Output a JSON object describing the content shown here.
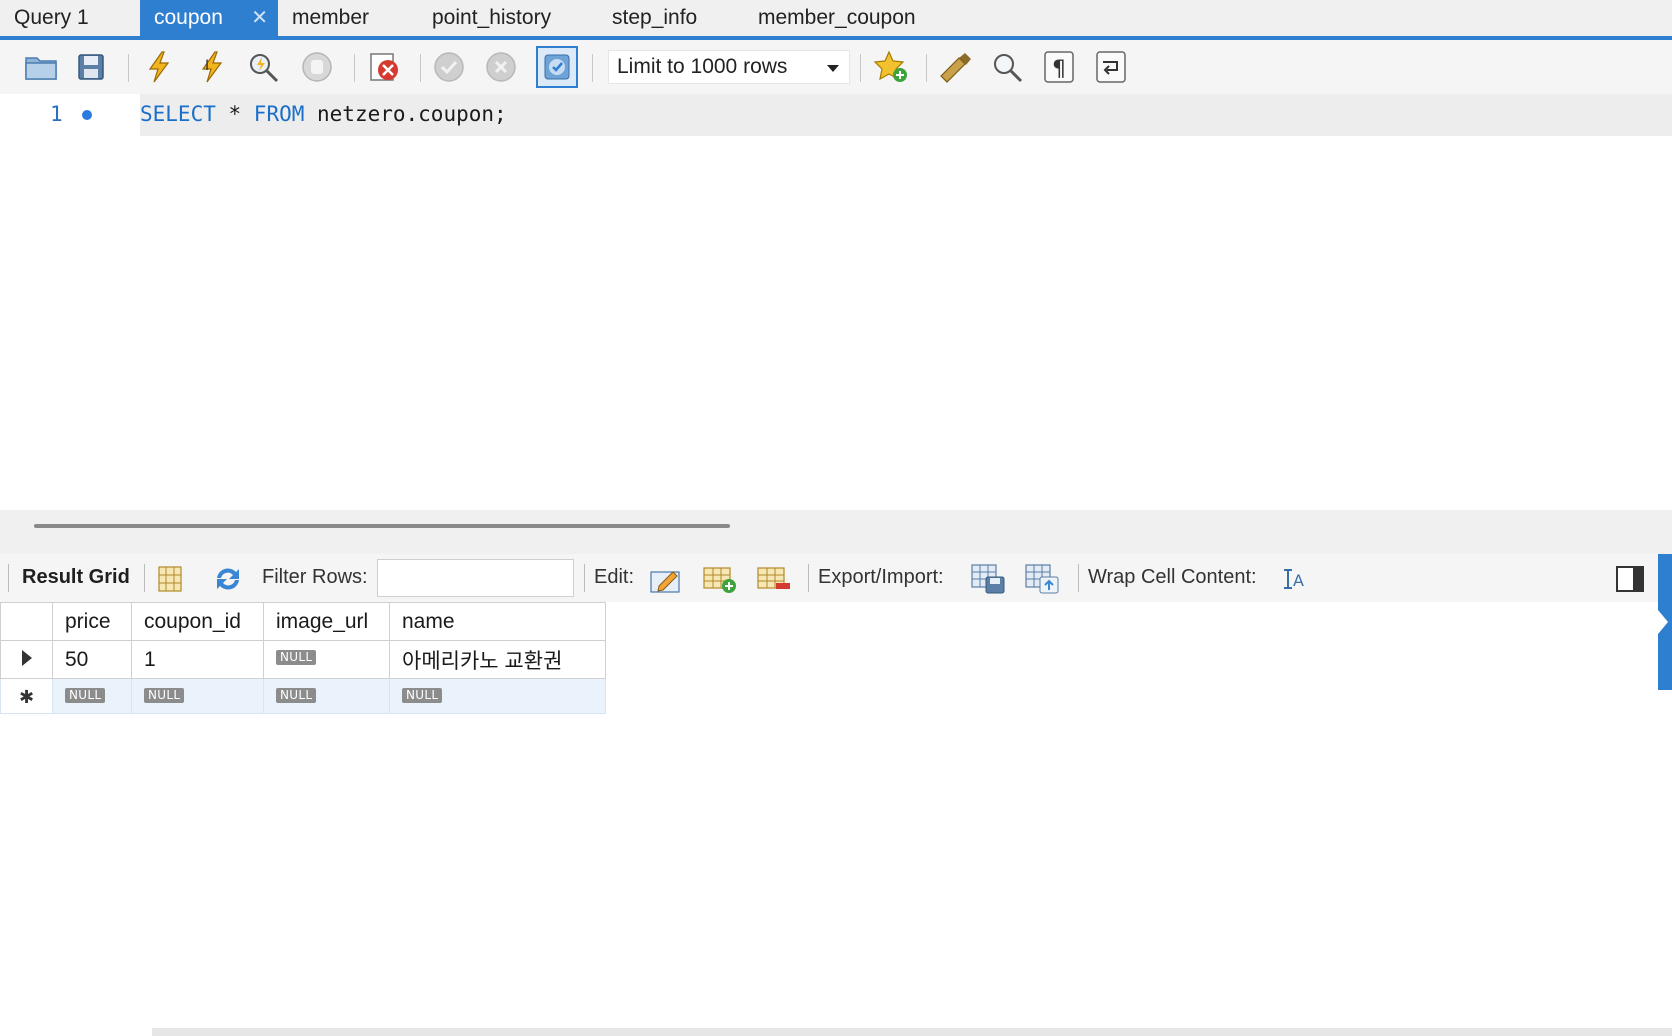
{
  "tabs": [
    {
      "label": "Query 1",
      "active": false
    },
    {
      "label": "coupon",
      "active": true,
      "close": "✕"
    },
    {
      "label": "member",
      "active": false
    },
    {
      "label": "point_history",
      "active": false
    },
    {
      "label": "step_info",
      "active": false
    },
    {
      "label": "member_coupon",
      "active": false
    }
  ],
  "toolbar": {
    "limit_value": "Limit to 1000 rows",
    "icons": [
      "open-file-icon",
      "save-icon",
      "execute-icon",
      "execute-current-icon",
      "explain-icon",
      "stop-icon",
      "toggle-error-icon",
      "commit-icon",
      "rollback-icon",
      "autocommit-icon",
      "bookmark-icon",
      "beautify-icon",
      "find-icon",
      "invisible-chars-icon",
      "wrap-icon"
    ]
  },
  "editor": {
    "line_number": "1",
    "code": {
      "kw1": "SELECT",
      "p1": " * ",
      "kw2": "FROM",
      "p2": " netzero.coupon;"
    }
  },
  "result_toolbar": {
    "result_grid_label": "Result Grid",
    "filter_label": "Filter Rows:",
    "filter_value": "",
    "edit_label": "Edit:",
    "export_label": "Export/Import:",
    "wrap_label": "Wrap Cell Content:"
  },
  "grid": {
    "columns": [
      "price",
      "coupon_id",
      "image_url",
      "name"
    ],
    "rows": [
      {
        "price": "50",
        "coupon_id": "1",
        "image_url": "NULL",
        "name": "아메리카노 교환권"
      }
    ],
    "new_row": {
      "price": "NULL",
      "coupon_id": "NULL",
      "image_url": "NULL",
      "name": "NULL"
    }
  },
  "colors": {
    "accent": "#2f7fd1",
    "keyword": "#1a6fc9",
    "null_badge": "#8c8c8c",
    "new_row_bg": "#eaf2fc"
  }
}
